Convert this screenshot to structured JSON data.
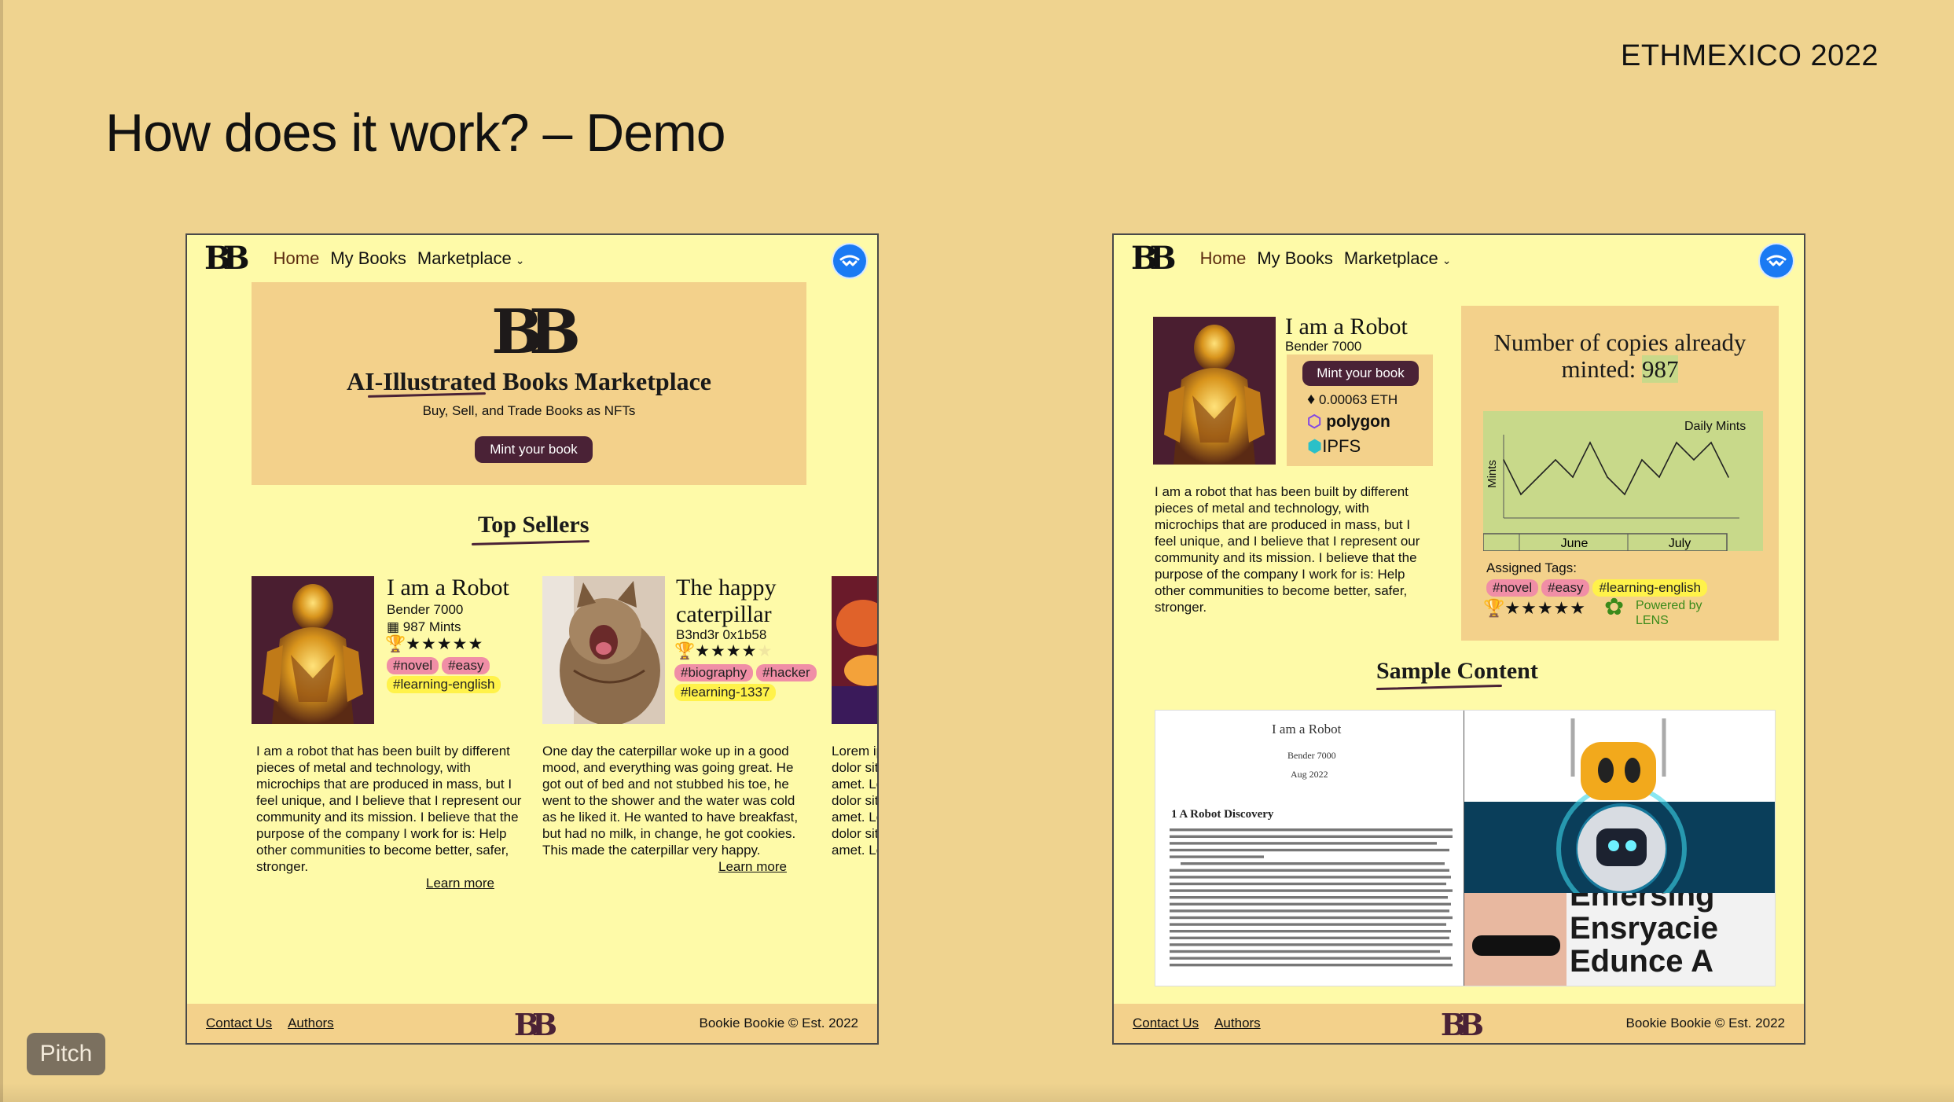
{
  "slide": {
    "brand": "ETHMEXICO 2022",
    "title": "How does it work? – Demo",
    "pitch_badge": "Pitch"
  },
  "nav": {
    "logo": "BB",
    "home": "Home",
    "my_books": "My Books",
    "marketplace": "Marketplace"
  },
  "home_page": {
    "hero": {
      "title": "AI-Illustrated Books Marketplace",
      "subtitle": "Buy, Sell, and Trade Books as NFTs",
      "button": "Mint your book"
    },
    "top_sellers_title": "Top Sellers",
    "books": [
      {
        "title": "I am a Robot",
        "author": "Bender 7000",
        "mints": "987 Mints",
        "rating": 5,
        "tags": [
          "#novel",
          "#easy",
          "#learning-english"
        ],
        "description": "I am a robot that has been built by different pieces of metal and technology, with microchips that are produced in mass, but I feel unique, and I believe that I represent our community and its mission. I believe that the purpose of the company I work for is: Help other communities to become better, safer, stronger.",
        "link": "Learn more"
      },
      {
        "title": "The happy caterpillar",
        "author": "B3nd3r 0x1b58",
        "rating": 4,
        "tags": [
          "#biography",
          "#hacker",
          "#learning-1337"
        ],
        "description": "One day the caterpillar woke up in a good mood, and everything was going great. He got out of bed and not stubbed his toe, he went to the shower and the water was cold as he liked it. He wanted to have breakfast, but had no milk, in change, he got cookies. This made the caterpillar very happy.",
        "link": "Learn more"
      },
      {
        "description_lines": [
          "Lorem ip",
          "dolor sit",
          "amet. Lo",
          "dolor sit",
          "amet. Lo",
          "dolor sit",
          "amet. Lo"
        ]
      }
    ]
  },
  "detail_page": {
    "book": {
      "title": "I am a Robot",
      "author": "Bender 7000",
      "mint_button": "Mint your book",
      "price": "0.00063 ETH",
      "network": "polygon",
      "storage": "IPFS",
      "description": "I am a robot that has been built by different pieces of metal and technology, with microchips that are produced in mass, but I feel unique, and I believe that I represent our community and its mission. I believe that the purpose of the company I work for is: Help other communities to become better, safer, stronger."
    },
    "stats": {
      "copies_label": "Number of copies already minted:",
      "copies_value": "987",
      "assigned_tags_label": "Assigned Tags:",
      "tags": [
        "#novel",
        "#easy",
        "#learning-english"
      ],
      "rating": 5,
      "powered_by": "Powered by",
      "lens": "LENS"
    },
    "sample_title": "Sample Content",
    "sample": {
      "paper_title": "I am a Robot",
      "paper_author": "Bender 7000",
      "paper_date": "Aug 2022",
      "section": "1   A Robot Discovery",
      "overlay_text": [
        "Enfersing",
        "Ensryacie",
        "Edunce A"
      ]
    }
  },
  "chart_data": {
    "type": "line",
    "title": "Daily Mints",
    "xlabel": "",
    "ylabel": "Mints",
    "x_tick_labels": [
      "June",
      "July"
    ],
    "series": [
      {
        "values": [
          3,
          1,
          2,
          3,
          2,
          4,
          2,
          1,
          3,
          2,
          4,
          3,
          4,
          2
        ]
      }
    ],
    "grid": false
  },
  "footer": {
    "contact": "Contact Us",
    "authors": "Authors",
    "copyright": "Bookie Bookie © Est. 2022"
  },
  "colors": {
    "slide_bg": "#efd38f",
    "page_bg": "#fefaa8",
    "accent": "#4a2236",
    "panel": "#f3d18b",
    "tag_pink": "#f08ea6",
    "tag_yellow": "#fff24a",
    "chart_bg": "#c8d98a"
  }
}
